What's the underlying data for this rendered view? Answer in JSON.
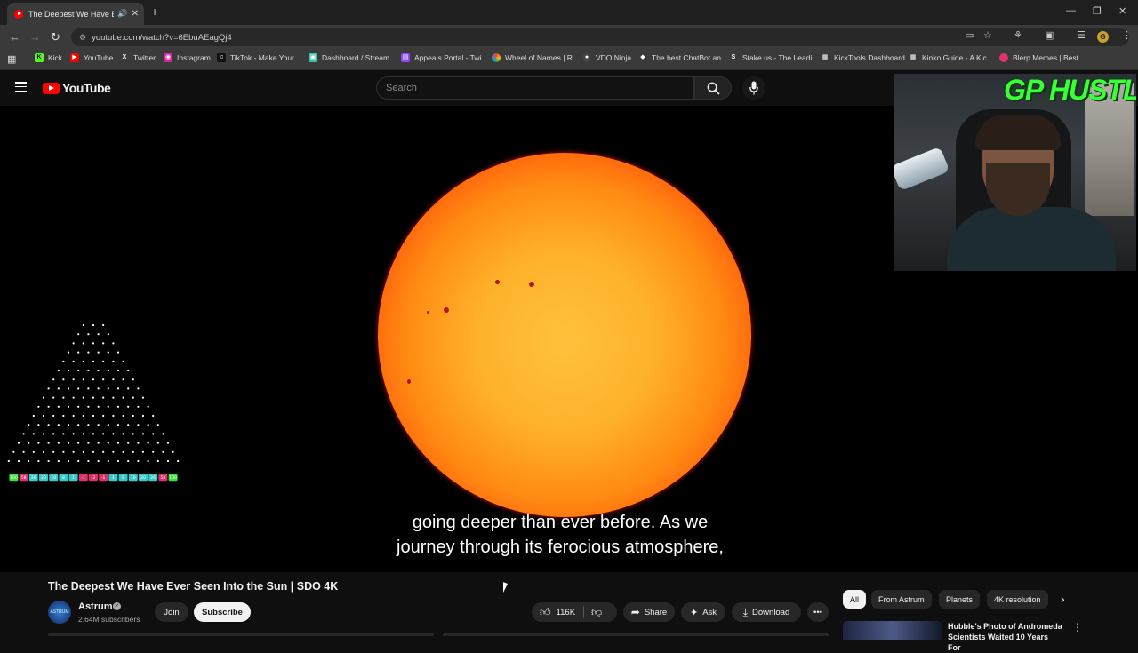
{
  "browser": {
    "tab_title": "The Deepest We Have Ever",
    "new_tab": "+",
    "url": "youtube.com/watch?v=6EbuAEagQj4",
    "profile_initial": "G",
    "bookmarks": [
      {
        "label": "Kick",
        "icon": "kick-icon",
        "color": "#53fc18"
      },
      {
        "label": "YouTube",
        "icon": "youtube-icon",
        "color": "#ff0000"
      },
      {
        "label": "Twitter",
        "icon": "x-icon",
        "color": "#000000"
      },
      {
        "label": "Instagram",
        "icon": "instagram-icon",
        "color": "#d6249f"
      },
      {
        "label": "TikTok - Make Your...",
        "icon": "tiktok-icon",
        "color": "#111111"
      },
      {
        "label": "Dashboard / Stream...",
        "icon": "streamlabs-icon",
        "color": "#31c3a2"
      },
      {
        "label": "Appeals Portal - Twi...",
        "icon": "twitch-icon",
        "color": "#9146ff"
      },
      {
        "label": "Wheel of Names | R...",
        "icon": "wheel-icon",
        "color": "#3369e8"
      },
      {
        "label": "VDO.Ninja",
        "icon": "vdo-icon",
        "color": "#444444"
      },
      {
        "label": "The best ChatBot an...",
        "icon": "chatbot-icon",
        "color": "#222222"
      },
      {
        "label": "Stake.us - The Leadi...",
        "icon": "stake-icon",
        "color": "#1a2c38"
      },
      {
        "label": "KickTools Dashboard",
        "icon": "grid-icon",
        "color": "#333333"
      },
      {
        "label": "Kinko Guide - A Kic...",
        "icon": "grid-icon",
        "color": "#333333"
      },
      {
        "label": "Blerp Memes | Best...",
        "icon": "blerp-icon",
        "color": "#e2336b"
      }
    ]
  },
  "youtube": {
    "logo_text": "YouTube",
    "search_placeholder": "Search"
  },
  "video": {
    "caption_line1": "going deeper than ever before. As we",
    "caption_line2": "journey through its ferocious atmosphere,",
    "overlay_logo": "GP HUSTLA",
    "plinko_slots": [
      "100",
      "58",
      "26",
      "20",
      "10",
      "8",
      "1",
      "-1",
      "-2",
      "-1",
      "1",
      "8",
      "10",
      "20",
      "26",
      "58",
      "100"
    ],
    "plinko_colors": [
      "#38e038",
      "#e0306a",
      "#38c8c8",
      "#38c8c8",
      "#38c8c8",
      "#38c8c8",
      "#38c8c8",
      "#e0306a",
      "#e0306a",
      "#e0306a",
      "#38c8c8",
      "#38c8c8",
      "#38c8c8",
      "#38c8c8",
      "#38c8c8",
      "#e0306a",
      "#38e038"
    ]
  },
  "details": {
    "title": "The Deepest We Have Ever Seen Into the Sun | SDO 4K",
    "channel": "Astrum",
    "avatar_text": "ASTRUM",
    "subscribers": "2.64M subscribers",
    "join": "Join",
    "subscribe": "Subscribe",
    "likes": "116K",
    "share": "Share",
    "ask": "Ask",
    "download": "Download"
  },
  "chips": [
    "All",
    "From Astrum",
    "Planets",
    "4K resolution"
  ],
  "recommendation": {
    "title": "Hubble's Photo of Andromeda Scientists Waited 10 Years For"
  }
}
